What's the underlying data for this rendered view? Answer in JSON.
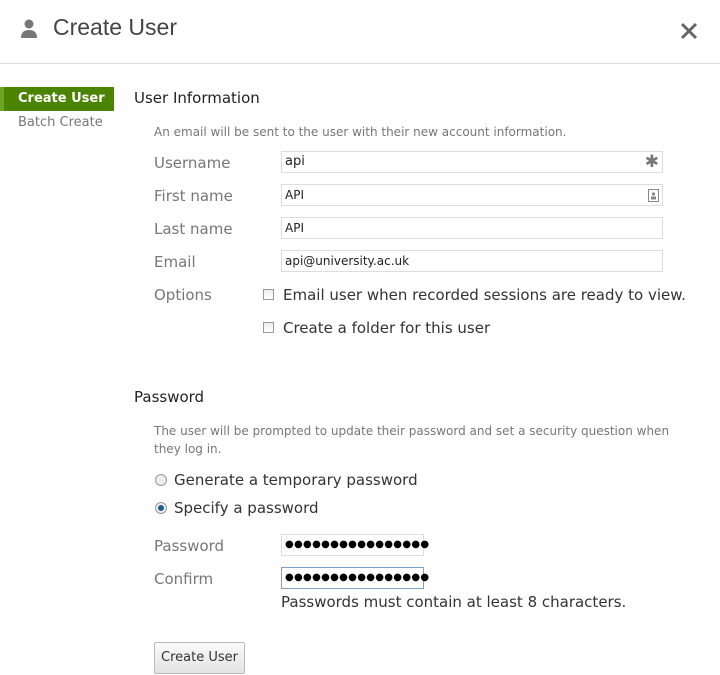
{
  "header": {
    "title": "Create User",
    "icon": "user-icon",
    "close_icon": "close-icon"
  },
  "sidebar": {
    "items": [
      {
        "label": "Create User",
        "active": true
      },
      {
        "label": "Batch Create",
        "active": false
      }
    ]
  },
  "user_info": {
    "heading": "User Information",
    "description": "An email will be sent to the user with their new account information.",
    "fields": [
      {
        "label": "Username",
        "value": "api",
        "icon": "required-asterisk-icon"
      },
      {
        "label": "First name",
        "value": "API",
        "icon": "contact-card-icon"
      },
      {
        "label": "Last name",
        "value": "API"
      },
      {
        "label": "Email",
        "value": "api@university.ac.uk"
      }
    ],
    "options_label": "Options",
    "options": [
      {
        "label": "Email user when recorded sessions are ready to view.",
        "checked": false
      },
      {
        "label": "Create a folder for this user",
        "checked": false
      }
    ]
  },
  "password": {
    "heading": "Password",
    "description_line1": "The user will be prompted to update their password and set a security question when",
    "description_line2": "they log in.",
    "radios": [
      {
        "label": "Generate a temporary password",
        "selected": false
      },
      {
        "label": "Specify a password",
        "selected": true
      }
    ],
    "password_label": "Password",
    "password_value": "●●●●●●●●●●●●●●●●",
    "confirm_label": "Confirm",
    "confirm_value": "●●●●●●●●●●●●●●●●",
    "hint": "Passwords must contain at least 8 characters."
  },
  "submit_label": "Create User",
  "colors": {
    "accent": "#4b8400"
  }
}
